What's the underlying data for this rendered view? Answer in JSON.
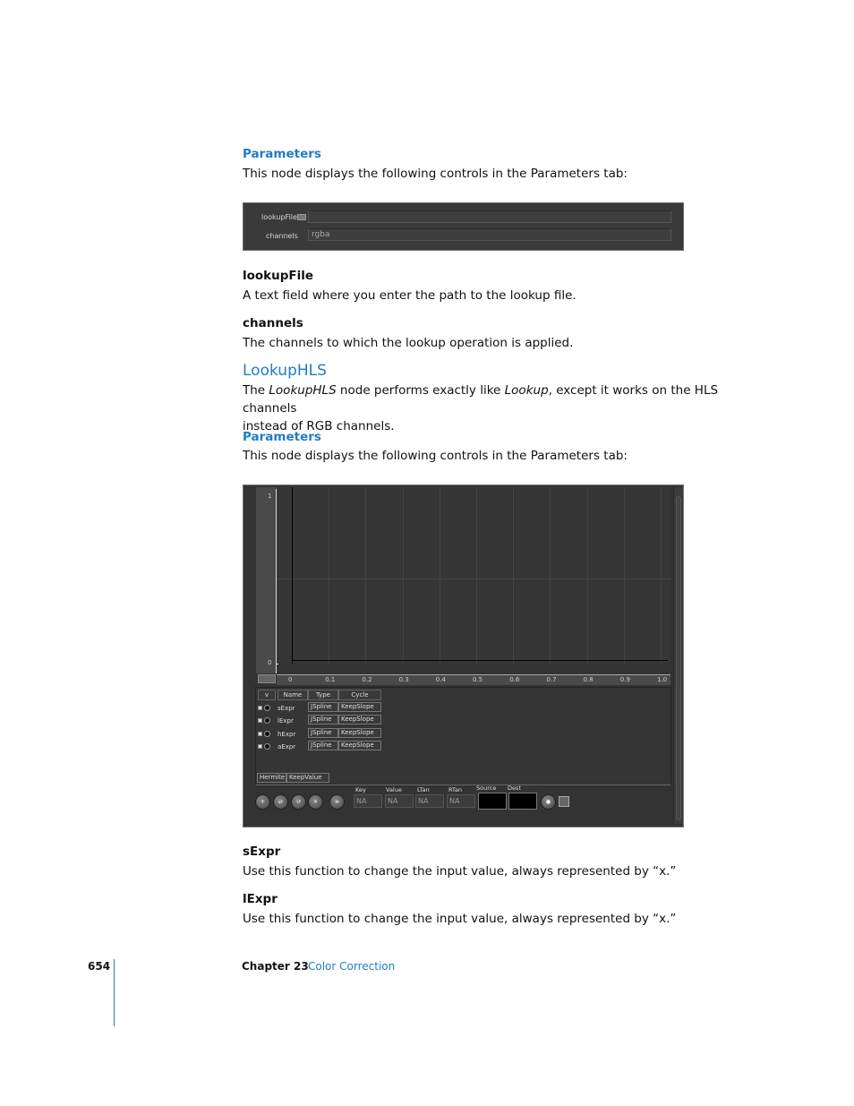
{
  "section1": {
    "heading": "Parameters",
    "intro": "This node displays the following controls in the Parameters tab:",
    "panel": {
      "lookupfile_label": "lookupFile",
      "lookupfile_value": "",
      "channels_label": "channels",
      "channels_value": "rgba"
    },
    "params": [
      {
        "name": "lookupFile",
        "desc": "A text field where you enter the path to the lookup file."
      },
      {
        "name": "channels",
        "desc": "The channels to which the lookup operation is applied."
      }
    ]
  },
  "lookuphls": {
    "title": "LookupHLS",
    "desc_pre": "The ",
    "desc_em1": "LookupHLS",
    "desc_mid": " node performs exactly like ",
    "desc_em2": "Lookup",
    "desc_post": ", except it works on the HLS channels",
    "desc_line2": "instead of RGB channels.",
    "params_heading": "Parameters",
    "params_intro": "This node displays the following controls in the Parameters tab:"
  },
  "curve_editor": {
    "y_ticks": [
      "1",
      "0"
    ],
    "x_ticks": [
      "0",
      "0.1",
      "0.2",
      "0.3",
      "0.4",
      "0.5",
      "0.6",
      "0.7",
      "0.8",
      "0.9",
      "1.0"
    ],
    "columns": [
      "v",
      "Name",
      "Type",
      "Cycle"
    ],
    "rows": [
      {
        "name": "sExpr",
        "type": "JSpline",
        "cycle": "KeepSlope"
      },
      {
        "name": "lExpr",
        "type": "JSpline",
        "cycle": "KeepSlope"
      },
      {
        "name": "hExpr",
        "type": "JSpline",
        "cycle": "KeepSlope"
      },
      {
        "name": "aExpr",
        "type": "JSpline",
        "cycle": "KeepSlope"
      }
    ],
    "footer_type": "Hermite",
    "footer_cycle": "KeepValue",
    "toolbar_buttons": [
      "home-view",
      "bound",
      "reset",
      "fit-curves",
      "snap"
    ],
    "fields": [
      {
        "label": "Key",
        "value": "NA"
      },
      {
        "label": "Value",
        "value": "NA"
      },
      {
        "label": "LTan",
        "value": "NA"
      },
      {
        "label": "RTan",
        "value": "NA"
      }
    ],
    "source_label": "Source",
    "dest_label": "Dest"
  },
  "section2_params": [
    {
      "name": "sExpr",
      "desc": "Use this function to change the input value, always represented by “x.”"
    },
    {
      "name": "lExpr",
      "desc": "Use this function to change the input value, always represented by “x.”"
    }
  ],
  "footer": {
    "page_number": "654",
    "chapter": "Chapter 23",
    "chapter_title": "Color Correction"
  }
}
